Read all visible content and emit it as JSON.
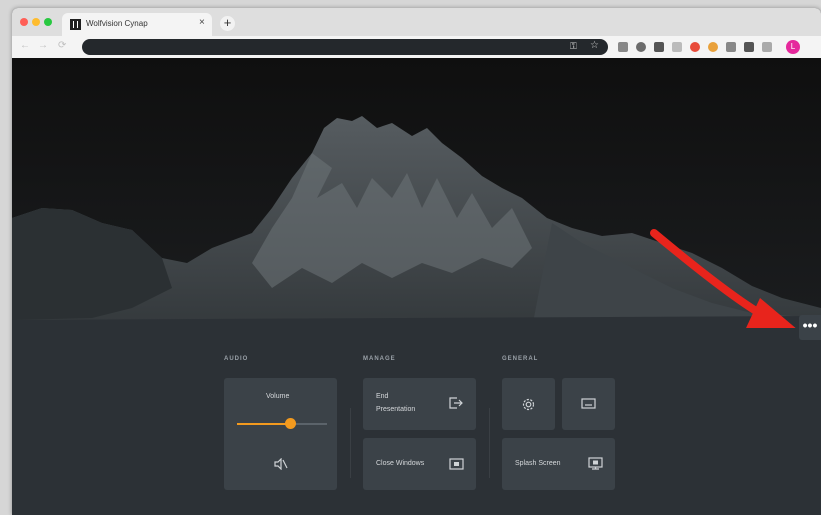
{
  "browser": {
    "tab_title": "Wolfvision Cynap",
    "tab_close": "×",
    "new_tab": "+",
    "nav_back": "←",
    "nav_forward": "→",
    "nav_reload": "⟳",
    "omnibox_key_icon": "⚿",
    "omnibox_star_icon": "☆",
    "profile_initial": "L",
    "traffic_colors": [
      "#ff5f57",
      "#febc2e",
      "#28c840"
    ]
  },
  "panel": {
    "audio": {
      "label": "AUDIO",
      "volume_label": "Volume",
      "volume_level": 0.6,
      "mute_icon": "speaker-muted-icon"
    },
    "manage": {
      "label": "MANAGE",
      "end_presentation_line1": "End",
      "end_presentation_line2": "Presentation",
      "close_windows": "Close Windows"
    },
    "general": {
      "label": "GENERAL",
      "settings_icon": "gear-icon",
      "screen_icon": "screen-icon",
      "splash_screen": "Splash Screen"
    }
  },
  "more_menu": "•••",
  "accent_color": "#f39a1e",
  "annotation_arrow_color": "#e8241c"
}
